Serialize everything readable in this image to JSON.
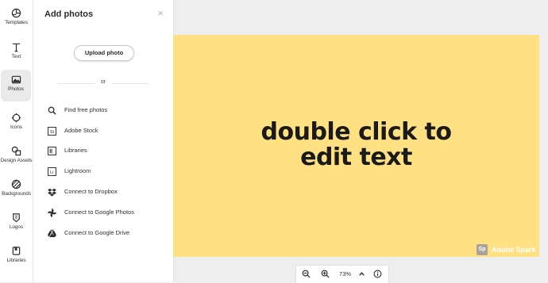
{
  "sidebar": {
    "items": [
      {
        "label": "Templates",
        "icon": "templates-icon"
      },
      {
        "label": "Text",
        "icon": "text-icon"
      },
      {
        "label": "Photos",
        "icon": "photos-icon",
        "active": true
      },
      {
        "label": "Icons",
        "icon": "icons-icon"
      },
      {
        "label": "Design Assets",
        "icon": "design-assets-icon"
      },
      {
        "label": "Backgrounds",
        "icon": "backgrounds-icon"
      },
      {
        "label": "Logos",
        "icon": "logos-icon"
      },
      {
        "label": "Libraries",
        "icon": "libraries-icon"
      }
    ]
  },
  "panel": {
    "title": "Add photos",
    "upload_label": "Upload photo",
    "or_label": "or",
    "options": [
      {
        "label": "Find free photos",
        "icon": "search-icon"
      },
      {
        "label": "Adobe Stock",
        "icon": "adobe-stock-icon"
      },
      {
        "label": "Libraries",
        "icon": "libraries-icon"
      },
      {
        "label": "Lightroom",
        "icon": "lightroom-icon"
      },
      {
        "label": "Connect to Dropbox",
        "icon": "dropbox-icon"
      },
      {
        "label": "Connect to Google Photos",
        "icon": "google-photos-icon"
      },
      {
        "label": "Connect to Google Drive",
        "icon": "google-drive-icon"
      }
    ]
  },
  "canvas": {
    "line1": "double click to",
    "line2": "edit text",
    "background": "#ffe083",
    "watermark_logo": "Sp",
    "watermark_text": "Adobe Spark"
  },
  "zoom": {
    "value": "73%"
  }
}
